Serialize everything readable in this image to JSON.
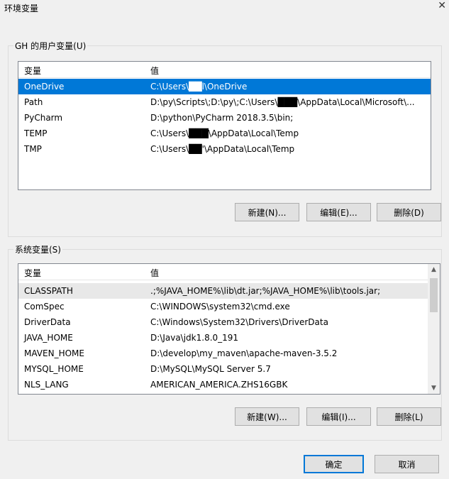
{
  "window": {
    "title": "环境变量",
    "close_glyph": "✕"
  },
  "user_vars": {
    "group_label": "GH 的用户变量(U)",
    "columns": [
      "变量",
      "值"
    ],
    "rows": [
      {
        "name": "OneDrive",
        "value": "C:\\Users\\██l\\OneDrive"
      },
      {
        "name": "Path",
        "value": "D:\\py\\Scripts\\;D:\\py\\;C:\\Users\\███\\AppData\\Local\\Microsoft\\..."
      },
      {
        "name": "PyCharm",
        "value": "D:\\python\\PyCharm 2018.3.5\\bin;"
      },
      {
        "name": "TEMP",
        "value": "C:\\Users\\███\\AppData\\Local\\Temp"
      },
      {
        "name": "TMP",
        "value": "C:\\Users\\██'\\AppData\\Local\\Temp"
      }
    ],
    "buttons": {
      "new": "新建(N)...",
      "edit": "编辑(E)...",
      "delete": "删除(D)"
    }
  },
  "system_vars": {
    "group_label": "系统变量(S)",
    "columns": [
      "变量",
      "值"
    ],
    "rows": [
      {
        "name": "CLASSPATH",
        "value": ".;%JAVA_HOME%\\lib\\dt.jar;%JAVA_HOME%\\lib\\tools.jar;"
      },
      {
        "name": "ComSpec",
        "value": "C:\\WINDOWS\\system32\\cmd.exe"
      },
      {
        "name": "DriverData",
        "value": "C:\\Windows\\System32\\Drivers\\DriverData"
      },
      {
        "name": "JAVA_HOME",
        "value": "D:\\Java\\jdk1.8.0_191"
      },
      {
        "name": "MAVEN_HOME",
        "value": "D:\\develop\\my_maven\\apache-maven-3.5.2"
      },
      {
        "name": "MYSQL_HOME",
        "value": "D:\\MySQL\\MySQL Server 5.7"
      },
      {
        "name": "NLS_LANG",
        "value": "AMERICAN_AMERICA.ZHS16GBK"
      }
    ],
    "buttons": {
      "new": "新建(W)...",
      "edit": "编辑(I)...",
      "delete": "删除(L)"
    }
  },
  "footer": {
    "ok": "确定",
    "cancel": "取消"
  },
  "colors": {
    "selection": "#0078d7",
    "accent_border": "#0078d7"
  }
}
